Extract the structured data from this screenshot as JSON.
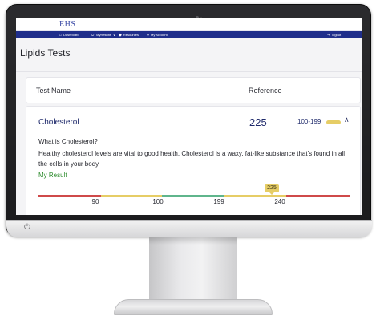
{
  "app": {
    "logo_text": "EHS"
  },
  "nav": {
    "items": [
      {
        "label": "Dashboard",
        "icon": "home-icon"
      },
      {
        "label": "MyResults",
        "icon": "person-icon"
      },
      {
        "label": "Resources",
        "icon": "resources-icon"
      },
      {
        "label": "My Account",
        "icon": "account-icon"
      }
    ],
    "logout_label": "logout"
  },
  "page": {
    "title": "Lipids Tests"
  },
  "table": {
    "headers": {
      "name": "Test Name",
      "reference": "Reference"
    }
  },
  "test": {
    "name": "Cholesterol",
    "value": "225",
    "range": "100-199",
    "status_color": "#e6cd66",
    "question": "What is Cholesterol?",
    "description": "Healthy cholesterol levels are vital to good health. Cholesterol is a waxy, fat-like substance that's found in all the cells in your body.",
    "my_result_label": "My Result",
    "my_result_color": "#2e8c2e"
  },
  "gauge": {
    "ticks": [
      "90",
      "100",
      "199",
      "240"
    ],
    "marker_value": "225",
    "colors": {
      "red": "#cf4a4a",
      "yellow": "#e6cd66",
      "green": "#5fb58c"
    }
  },
  "colors": {
    "nav_bg": "#1f2e8b",
    "text_accent": "#1f2a6b"
  }
}
